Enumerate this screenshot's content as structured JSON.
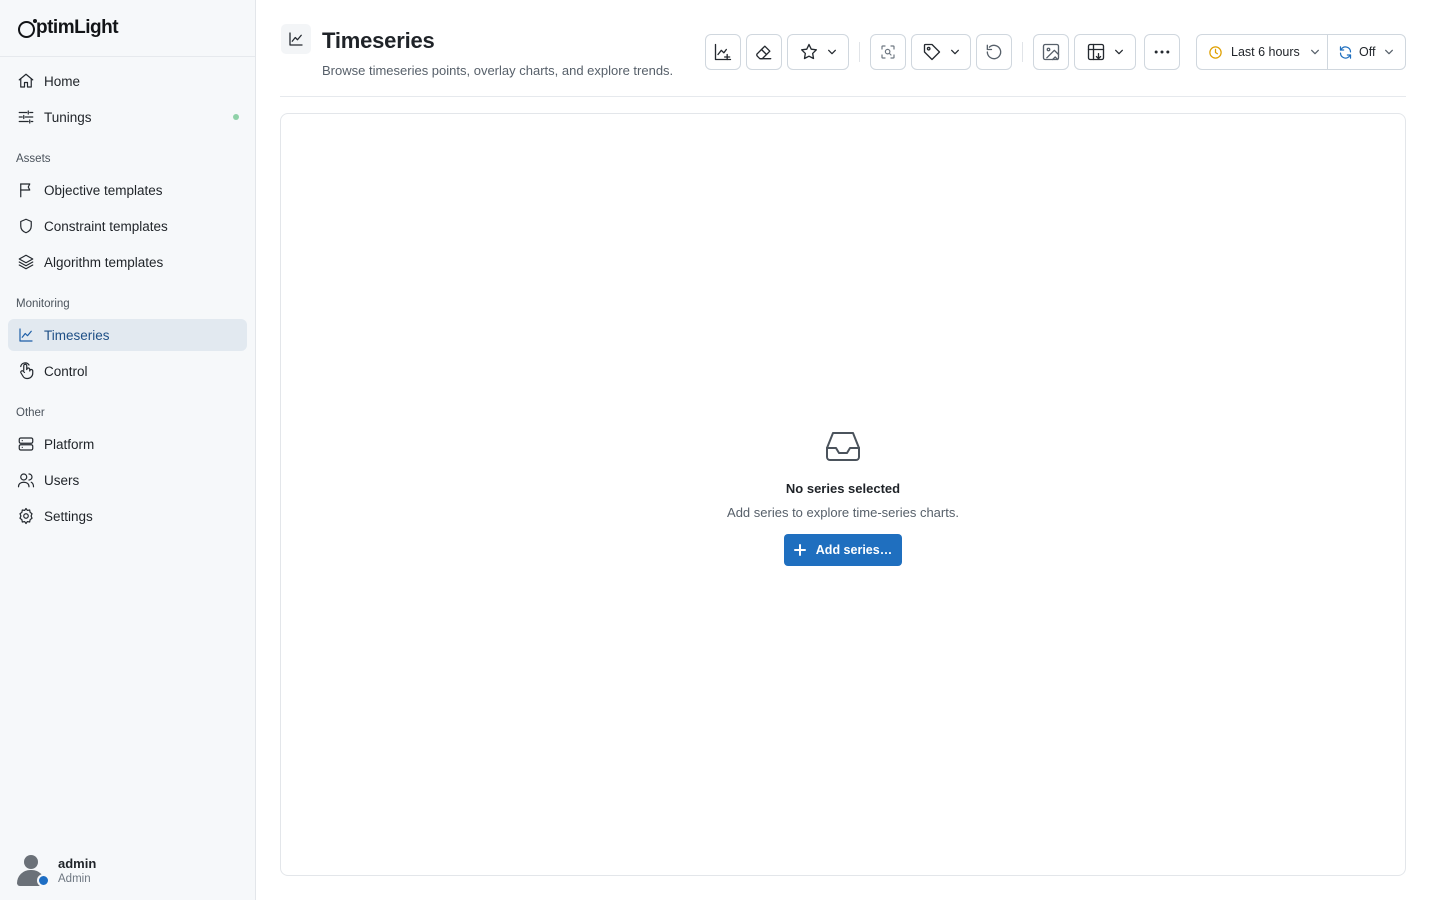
{
  "app": {
    "logo": "ptimLight"
  },
  "sidebar": {
    "top_items": [
      {
        "label": "Home",
        "icon": "home-icon"
      },
      {
        "label": "Tunings",
        "icon": "sliders-icon",
        "dot_color": "#8fd1a8"
      }
    ],
    "sections": [
      {
        "label": "Assets",
        "items": [
          {
            "label": "Objective templates",
            "icon": "flag-icon"
          },
          {
            "label": "Constraint templates",
            "icon": "shield-icon"
          },
          {
            "label": "Algorithm templates",
            "icon": "layers-icon"
          }
        ]
      },
      {
        "label": "Monitoring",
        "items": [
          {
            "label": "Timeseries",
            "icon": "chart-line-icon",
            "active": true
          },
          {
            "label": "Control",
            "icon": "hand-pointer-icon"
          }
        ]
      },
      {
        "label": "Other",
        "items": [
          {
            "label": "Platform",
            "icon": "server-icon"
          },
          {
            "label": "Users",
            "icon": "users-icon"
          },
          {
            "label": "Settings",
            "icon": "gear-icon"
          }
        ]
      }
    ],
    "user": {
      "name": "admin",
      "role": "Admin",
      "status_color": "#1e6ec4"
    }
  },
  "header": {
    "title": "Timeseries",
    "subtitle": "Browse timeseries points, overlay charts, and explore trends.",
    "toolbar": {
      "icons": [
        "add-chart-icon",
        "eraser-icon",
        "star-icon",
        "focus-scan-icon",
        "tag-icon",
        "reset-icon",
        "image-export-icon",
        "table-export-icon",
        "more-icon",
        "clock-icon",
        "refresh-icon"
      ],
      "time_range": "Last 6 hours",
      "auto_refresh": "Off"
    }
  },
  "empty_state": {
    "icon": "inbox-icon",
    "title": "No series selected",
    "description": "Add series to explore time-series charts.",
    "button_label": "Add series…"
  },
  "colors": {
    "accent": "#1f6fbf",
    "active_bg": "#e2e9f0",
    "active_text": "#1e4f86",
    "clock": "#e0a000",
    "refresh": "#1f6fbf"
  }
}
